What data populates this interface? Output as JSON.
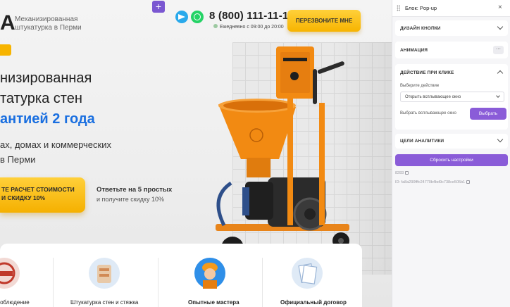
{
  "site": {
    "logo_letter": "A",
    "logo_subtitle_1": "Механизированная",
    "logo_subtitle_2": "штукатурка в Перми",
    "add_block_label": "+",
    "phone": "8 (800) 111-11-10",
    "hours": "Ежедневно с 09:00 до 20:00",
    "callback_label": "ПЕРЕЗВОНИТЕ МНЕ",
    "hero": {
      "line1": "низированная",
      "line2": "татурка стен",
      "line3": "антией 2 года",
      "sub1": "ах, домах и коммерческих",
      "sub2": "в Перми"
    },
    "cta_line1": "ТЕ РАСЧЕТ СТОИМОСТИ",
    "cta_line2": "И СКИДКУ 10%",
    "quiz_line1": "Ответьте на 5 простых",
    "quiz_line2": "и получите скидку 10%",
    "cards": [
      {
        "label": "соблюдение",
        "icon": "stamp-icon"
      },
      {
        "label": "Штукатурка стен и стяжка",
        "icon": "plaster-bags-icon"
      },
      {
        "label": "Опытные мастера",
        "icon": "worker-icon"
      },
      {
        "label": "Официальный договор",
        "icon": "contract-icon"
      }
    ]
  },
  "panel": {
    "title": "Блок: Pop-up",
    "close": "×",
    "sections": {
      "button_design": "ДИЗАЙН КНОПКИ",
      "animation": "АНИМАЦИЯ",
      "click_action": "ДЕЙСТВИЕ ПРИ КЛИКЕ",
      "analytics": "ЦЕЛИ АНАЛИТИКИ"
    },
    "dots": "···",
    "choose_action_label": "Выберите действие",
    "action_value": "Открыть всплывающее окно",
    "choose_popup_label": "Выбрать всплывающее окно",
    "choose_button": "Выбрать",
    "reset_button": "Сбросить настройки",
    "block_number": "8283",
    "block_id": "ID: fa8a290fffc24770b4bd9c738ce505b1"
  },
  "colors": {
    "accent_purple": "#8a5cd8",
    "cta_yellow": "#f7b400",
    "headline_blue": "#1a6fe0",
    "machine_orange": "#f28a12"
  }
}
